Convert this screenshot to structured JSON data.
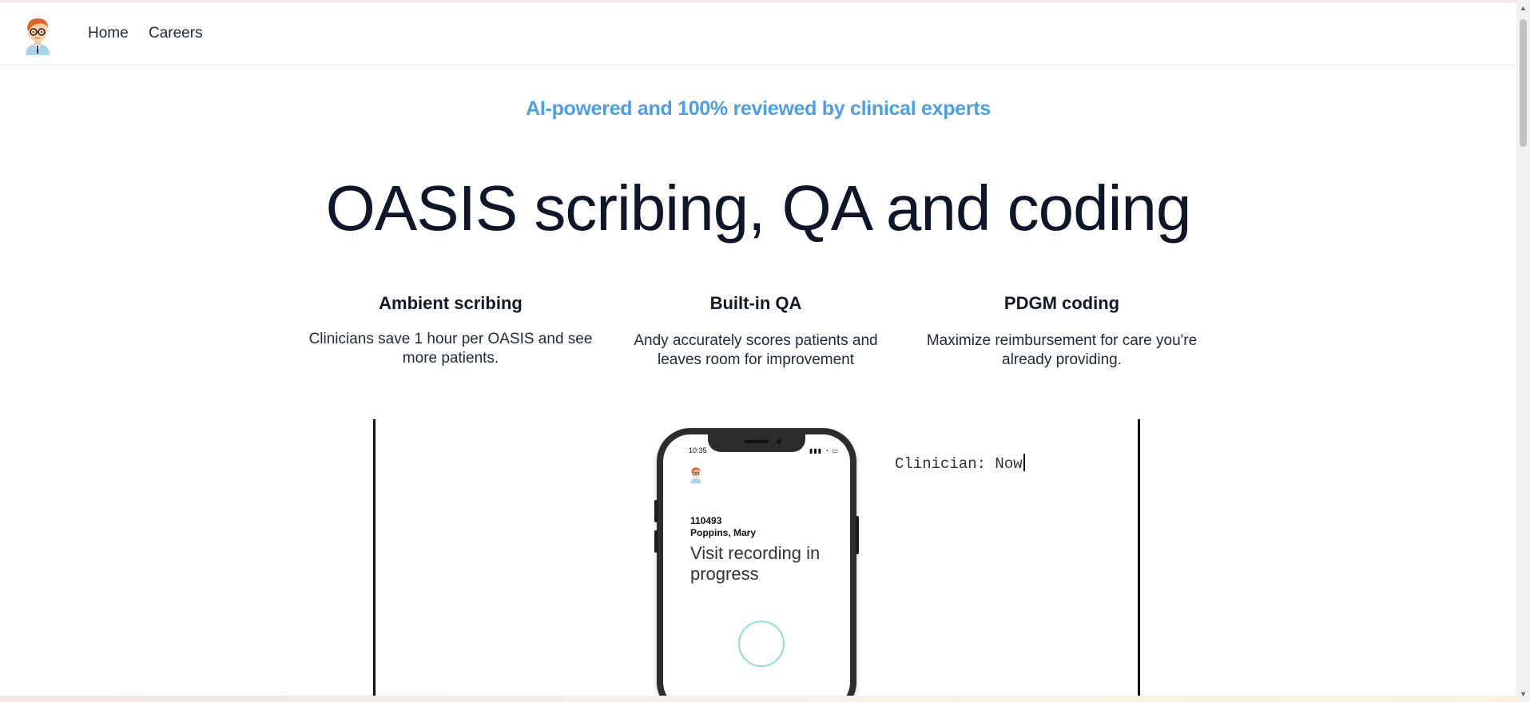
{
  "nav": {
    "home_label": "Home",
    "careers_label": "Careers"
  },
  "hero": {
    "tagline": "AI-powered and 100% reviewed by clinical experts",
    "headline": "OASIS scribing, QA and coding"
  },
  "features": [
    {
      "title": "Ambient scribing",
      "description": "Clinicians save 1 hour per OASIS and see more patients."
    },
    {
      "title": "Built-in QA",
      "description": "Andy accurately scores patients and leaves room for improvement"
    },
    {
      "title": "PDGM coding",
      "description": "Maximize reimbursement for care you're already providing."
    }
  ],
  "demo": {
    "transcript": "Clinician: Now",
    "phone": {
      "time": "10:35",
      "patient_id": "110493",
      "patient_name": "Poppins, Mary",
      "status": "Visit recording in progress"
    }
  },
  "colors": {
    "accent": "#4a9fe6",
    "headline": "#0f1629",
    "record_ring": "#8fe0cf"
  },
  "icons": {
    "logo": "doctor-avatar-icon",
    "scroll_up": "triangle-up-icon",
    "scroll_down": "triangle-down-icon"
  }
}
